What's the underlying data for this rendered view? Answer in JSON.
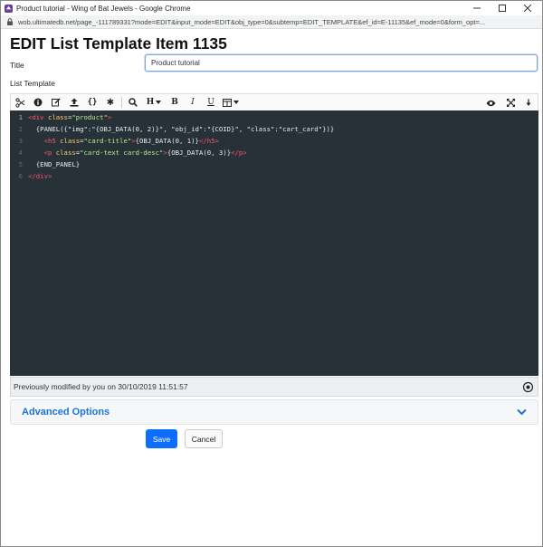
{
  "window": {
    "title": "Product tutorial - Wing of Bat Jewels - Google Chrome",
    "url": "wob.ultimatedb.net/page_-111789331?mode=EDIT&input_mode=EDIT&obj_type=0&subtemp=EDIT_TEMPLATE&ef_id=E-11135&ef_mode=0&form_opt=...",
    "controls": [
      "minimize-icon",
      "maximize-icon",
      "close-icon"
    ]
  },
  "page": {
    "heading": "EDIT List Template Item 1135",
    "title_label": "Title",
    "title_value": "Product tutorial",
    "list_template_label": "List Template"
  },
  "toolbar": {
    "left_icons": [
      "source-icon",
      "info-icon",
      "edit-icon",
      "upload-icon",
      "braces-icon",
      "asterisk-icon",
      "search-icon",
      "heading-icon",
      "bold-icon",
      "italic-icon",
      "underline-icon",
      "table-icon"
    ],
    "heading_label": "H",
    "bold_label": "B",
    "italic_label": "I",
    "underline_label": "U",
    "braces_label": "{}",
    "asterisk_label": "✱",
    "right_icons": [
      "preview-eye-icon",
      "fullscreen-icon",
      "wrap-icon"
    ]
  },
  "editor": {
    "line_numbers": [
      "1",
      "2",
      "3",
      "4",
      "5",
      "6"
    ],
    "lines": [
      [
        {
          "t": "tag",
          "v": "<div "
        },
        {
          "t": "attr",
          "v": "class"
        },
        {
          "t": "plain",
          "v": "="
        },
        {
          "t": "str",
          "v": "\"product\""
        },
        {
          "t": "tag",
          "v": ">"
        }
      ],
      [
        {
          "t": "plain",
          "v": "  {PANEL({\"img\":\"{OBJ_DATA(0, 2)}\", \"obj_id\":\"{COID}\", \"class\":\"cart_card\"})}"
        }
      ],
      [
        {
          "t": "plain",
          "v": "    "
        },
        {
          "t": "tag",
          "v": "<h5 "
        },
        {
          "t": "attr",
          "v": "class"
        },
        {
          "t": "plain",
          "v": "="
        },
        {
          "t": "str",
          "v": "\"card-title\""
        },
        {
          "t": "tag",
          "v": ">"
        },
        {
          "t": "plain",
          "v": "{OBJ_DATA(0, 1)}"
        },
        {
          "t": "tag",
          "v": "</h5>"
        }
      ],
      [
        {
          "t": "plain",
          "v": "    "
        },
        {
          "t": "tag",
          "v": "<p "
        },
        {
          "t": "attr",
          "v": "class"
        },
        {
          "t": "plain",
          "v": "="
        },
        {
          "t": "str",
          "v": "\"card-text card-desc\""
        },
        {
          "t": "tag",
          "v": ">"
        },
        {
          "t": "plain",
          "v": "{OBJ_DATA(0, 3)}"
        },
        {
          "t": "tag",
          "v": "</p>"
        }
      ],
      [
        {
          "t": "plain",
          "v": "  {END_PANEL}"
        }
      ],
      [
        {
          "t": "tag",
          "v": "</div>"
        }
      ]
    ]
  },
  "status": {
    "text": "Previously modified by you on 30/10/2019 11:51:57"
  },
  "advanced": {
    "label": "Advanced Options"
  },
  "buttons": {
    "save": "Save",
    "cancel": "Cancel"
  },
  "colors": {
    "accent": "#1a73d9",
    "save_bg": "#0d6efd",
    "editor_bg": "#263238",
    "tag": "#ff5370",
    "attr": "#ffcb6b",
    "string": "#c3e88d"
  }
}
